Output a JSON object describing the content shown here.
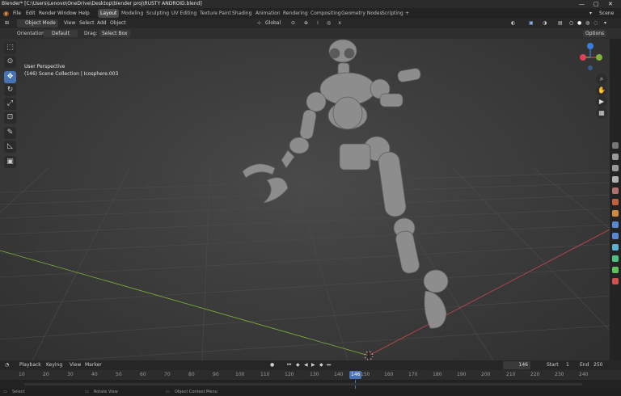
{
  "window": {
    "title": "Blender* [C:\\Users\\Lenovo\\OneDrive\\Desktop\\blender proj\\RUSTY ANDROID.blend]",
    "controls": [
      "—",
      "□",
      "✕"
    ]
  },
  "menu": {
    "items": [
      "File",
      "Edit",
      "Render",
      "Window",
      "Help"
    ],
    "workspaces": [
      "Layout",
      "Modeling",
      "Sculpting",
      "UV Editing",
      "Texture Paint",
      "Shading",
      "Animation",
      "Rendering",
      "Compositing",
      "Geometry Nodes",
      "Scripting"
    ],
    "active_workspace": "Layout",
    "add_tab": "+",
    "scene": "Scene"
  },
  "header": {
    "mode": "Object Mode",
    "menus": [
      "View",
      "Select",
      "Add",
      "Object"
    ],
    "transform_orientation": "Global",
    "options": "Options"
  },
  "tool_settings": {
    "orientation_label": "Orientation:",
    "orientation_value": "Default",
    "drag_label": "Drag:",
    "drag_value": "Select Box"
  },
  "viewport": {
    "view_name": "User Perspective",
    "collection_info": "(146) Scene Collection | Icosphere.003",
    "gizmo_axes": {
      "x": "X",
      "y": "Y",
      "z": "Z"
    },
    "axis_colors": {
      "x": "#e0405a",
      "y": "#7fb438",
      "z": "#3c7ee0"
    }
  },
  "timeline": {
    "menus": [
      "Playback",
      "Keying",
      "View",
      "Marker"
    ],
    "current_frame": "146",
    "start_label": "Start",
    "start_value": "1",
    "end_label": "End",
    "end_value": "250",
    "ruler": [
      "10",
      "20",
      "30",
      "40",
      "50",
      "60",
      "70",
      "80",
      "90",
      "100",
      "110",
      "120",
      "130",
      "140",
      "146",
      "150",
      "160",
      "170",
      "180",
      "190",
      "200",
      "210",
      "220",
      "230",
      "240"
    ],
    "playhead": "146"
  },
  "status_bar": {
    "items": [
      "Select",
      "Rotate View",
      "Object Context Menu"
    ]
  }
}
